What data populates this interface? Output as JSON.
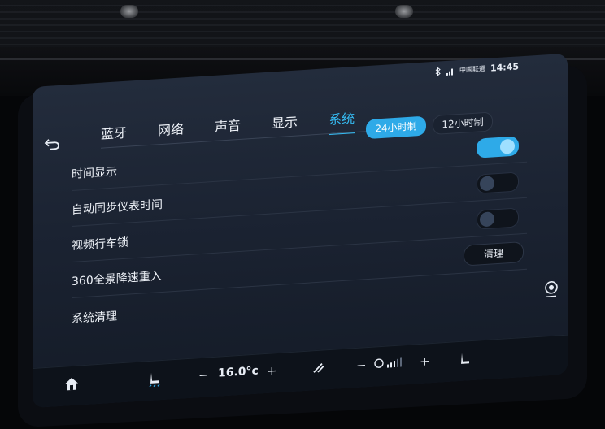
{
  "status": {
    "bluetooth_icon": "bluetooth-icon",
    "signal_icon": "signal-icon",
    "carrier": "中国联通",
    "time": "14:45"
  },
  "nav": {
    "back_icon": "back-arrow-icon",
    "tabs": [
      {
        "label": "蓝牙"
      },
      {
        "label": "网络"
      },
      {
        "label": "声音"
      },
      {
        "label": "显示"
      },
      {
        "label": "系统",
        "active": true
      }
    ]
  },
  "time_format": {
    "option_24": "24小时制",
    "option_12": "12小时制",
    "selected": "24小时制"
  },
  "settings": {
    "time_display": {
      "label": "时间显示",
      "enabled": true
    },
    "auto_sync": {
      "label": "自动同步仪表时间",
      "enabled": false
    },
    "video_lock": {
      "label": "视频行车锁",
      "enabled": false
    },
    "view360": {
      "label": "360全景降速重入",
      "button": "清理"
    },
    "system_clean": {
      "label": "系统清理"
    }
  },
  "dock": {
    "home_icon": "home-icon",
    "seat_heat_icon": "seat-heat-icon",
    "temp_minus": "−",
    "temperature": "16.0°c",
    "temp_plus": "+",
    "airflow_icon": "airflow-icon",
    "fan_minus": "−",
    "fan_icon": "fan-icon",
    "fan_plus": "+",
    "seat_icon": "seat-icon",
    "camera_icon": "camera-360-icon"
  },
  "colors": {
    "accent": "#2eaae8",
    "background": "#1b2332",
    "text": "#eef2f8"
  }
}
